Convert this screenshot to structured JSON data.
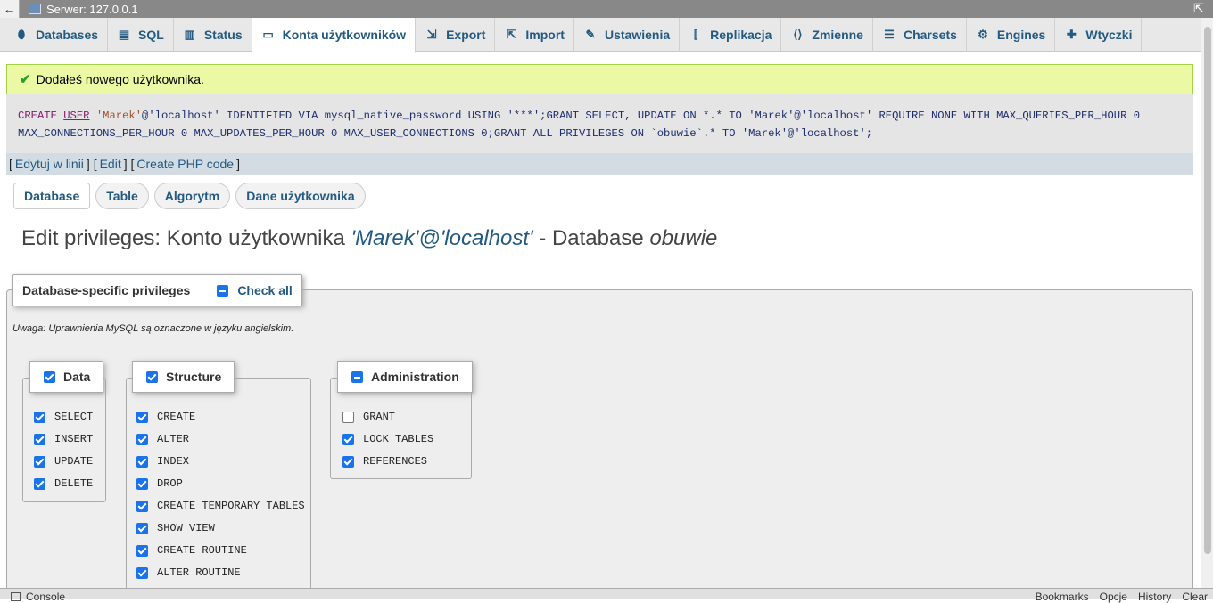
{
  "window": {
    "title": "Serwer: 127.0.0.1",
    "back_glyph": "←",
    "max_glyph": "⇱"
  },
  "tabs": [
    {
      "label": "Databases",
      "icon": "database-icon",
      "glyph": "⬮"
    },
    {
      "label": "SQL",
      "icon": "sql-icon",
      "glyph": "▤"
    },
    {
      "label": "Status",
      "icon": "status-icon",
      "glyph": "▥"
    },
    {
      "label": "Konta użytkowników",
      "icon": "users-icon",
      "glyph": "▭"
    },
    {
      "label": "Export",
      "icon": "export-icon",
      "glyph": "⇲"
    },
    {
      "label": "Import",
      "icon": "import-icon",
      "glyph": "⇱"
    },
    {
      "label": "Ustawienia",
      "icon": "wrench-icon",
      "glyph": "✎"
    },
    {
      "label": "Replikacja",
      "icon": "replication-icon",
      "glyph": "⫿"
    },
    {
      "label": "Zmienne",
      "icon": "variables-icon",
      "glyph": "⟨⟩"
    },
    {
      "label": "Charsets",
      "icon": "charsets-icon",
      "glyph": "☰"
    },
    {
      "label": "Engines",
      "icon": "engines-icon",
      "glyph": "⚙"
    },
    {
      "label": "Wtyczki",
      "icon": "plugin-icon",
      "glyph": "✚"
    }
  ],
  "active_tab": "Konta użytkowników",
  "message": {
    "text": "Dodałeś nowego użytkownika.",
    "icon": "checkmark-icon",
    "glyph": "✔"
  },
  "sql": {
    "kw_create": "CREATE",
    "kw_user": "USER",
    "user_str": "'Marek'",
    "line1_rest": "@'localhost' IDENTIFIED VIA mysql_native_password USING '***';GRANT SELECT, UPDATE ON *.* TO 'Marek'@'localhost' REQUIRE NONE WITH MAX_QUERIES_PER_HOUR 0",
    "line2": "MAX_CONNECTIONS_PER_HOUR 0 MAX_UPDATES_PER_HOUR 0 MAX_USER_CONNECTIONS 0;GRANT ALL PRIVILEGES ON `obuwie`.* TO 'Marek'@'localhost';"
  },
  "sql_links": {
    "edit_inline": "Edytuj w linii",
    "edit": "Edit",
    "create_php": "Create PHP code"
  },
  "subtabs": [
    "Database",
    "Table",
    "Algorytm",
    "Dane użytkownika"
  ],
  "page_title": {
    "prefix": "Edit privileges: Konto użytkownika ",
    "account": "'Marek'@'localhost'",
    "middle": " - Database ",
    "database": "obuwie"
  },
  "privileges": {
    "legend": "Database-specific privileges",
    "check_all": "Check all",
    "note": "Uwaga: Uprawnienia MySQL są oznaczone w języku angielskim.",
    "groups": [
      {
        "name": "Data",
        "state": "checked",
        "items": [
          {
            "label": "SELECT",
            "checked": true
          },
          {
            "label": "INSERT",
            "checked": true
          },
          {
            "label": "UPDATE",
            "checked": true
          },
          {
            "label": "DELETE",
            "checked": true
          }
        ]
      },
      {
        "name": "Structure",
        "state": "checked",
        "items": [
          {
            "label": "CREATE",
            "checked": true
          },
          {
            "label": "ALTER",
            "checked": true
          },
          {
            "label": "INDEX",
            "checked": true
          },
          {
            "label": "DROP",
            "checked": true
          },
          {
            "label": "CREATE TEMPORARY TABLES",
            "checked": true
          },
          {
            "label": "SHOW VIEW",
            "checked": true
          },
          {
            "label": "CREATE ROUTINE",
            "checked": true
          },
          {
            "label": "ALTER ROUTINE",
            "checked": true
          }
        ]
      },
      {
        "name": "Administration",
        "state": "indeterminate",
        "items": [
          {
            "label": "GRANT",
            "checked": false
          },
          {
            "label": "LOCK TABLES",
            "checked": true
          },
          {
            "label": "REFERENCES",
            "checked": true
          }
        ]
      }
    ]
  },
  "console": {
    "label": "Console",
    "right_items": [
      "Bookmarks",
      "Opcje",
      "History",
      "Clear"
    ]
  },
  "colors": {
    "accent": "#235a81",
    "success_bg": "#ebf8a4",
    "checkbox": "#1a73e8"
  }
}
